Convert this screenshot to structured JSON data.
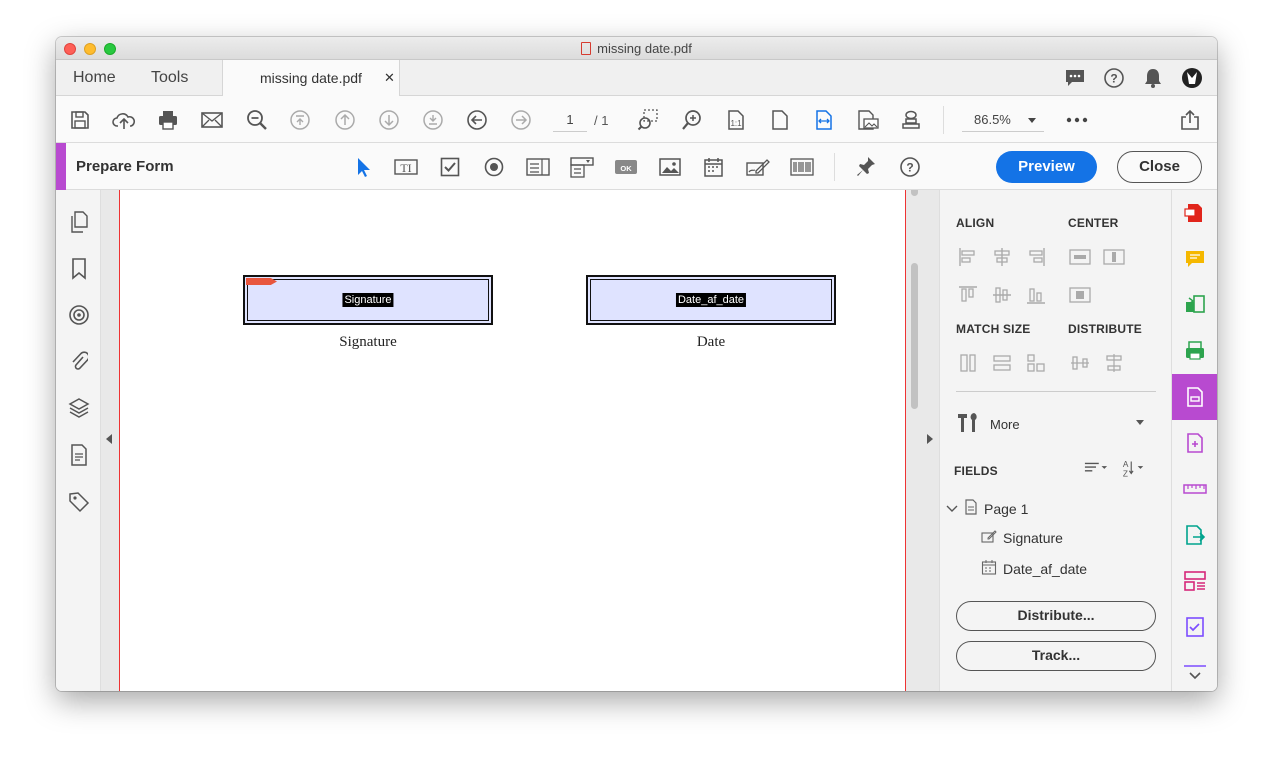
{
  "window": {
    "title": "missing date.pdf"
  },
  "tabs": {
    "home": "Home",
    "tools": "Tools",
    "document": "missing date.pdf"
  },
  "toolbar": {
    "page_current": "1",
    "page_total": "/ 1",
    "zoom": "86.5%"
  },
  "form_toolbar": {
    "title": "Prepare Form",
    "preview_label": "Preview",
    "close_label": "Close"
  },
  "document": {
    "fields": [
      {
        "label": "Signature",
        "caption": "Signature"
      },
      {
        "label": "Date_af_date",
        "caption": "Date"
      }
    ]
  },
  "right_panel": {
    "align": "ALIGN",
    "center": "CENTER",
    "match_size": "MATCH SIZE",
    "distribute": "DISTRIBUTE",
    "more": "More",
    "fields_heading": "FIELDS",
    "tree": {
      "page": "Page 1",
      "items": [
        "Signature",
        "Date_af_date"
      ]
    },
    "distribute_button": "Distribute...",
    "track_button": "Track..."
  },
  "colors": {
    "accent": "#b84ad0",
    "primary": "#1473e6",
    "field_fill": "#dfe3ff"
  }
}
